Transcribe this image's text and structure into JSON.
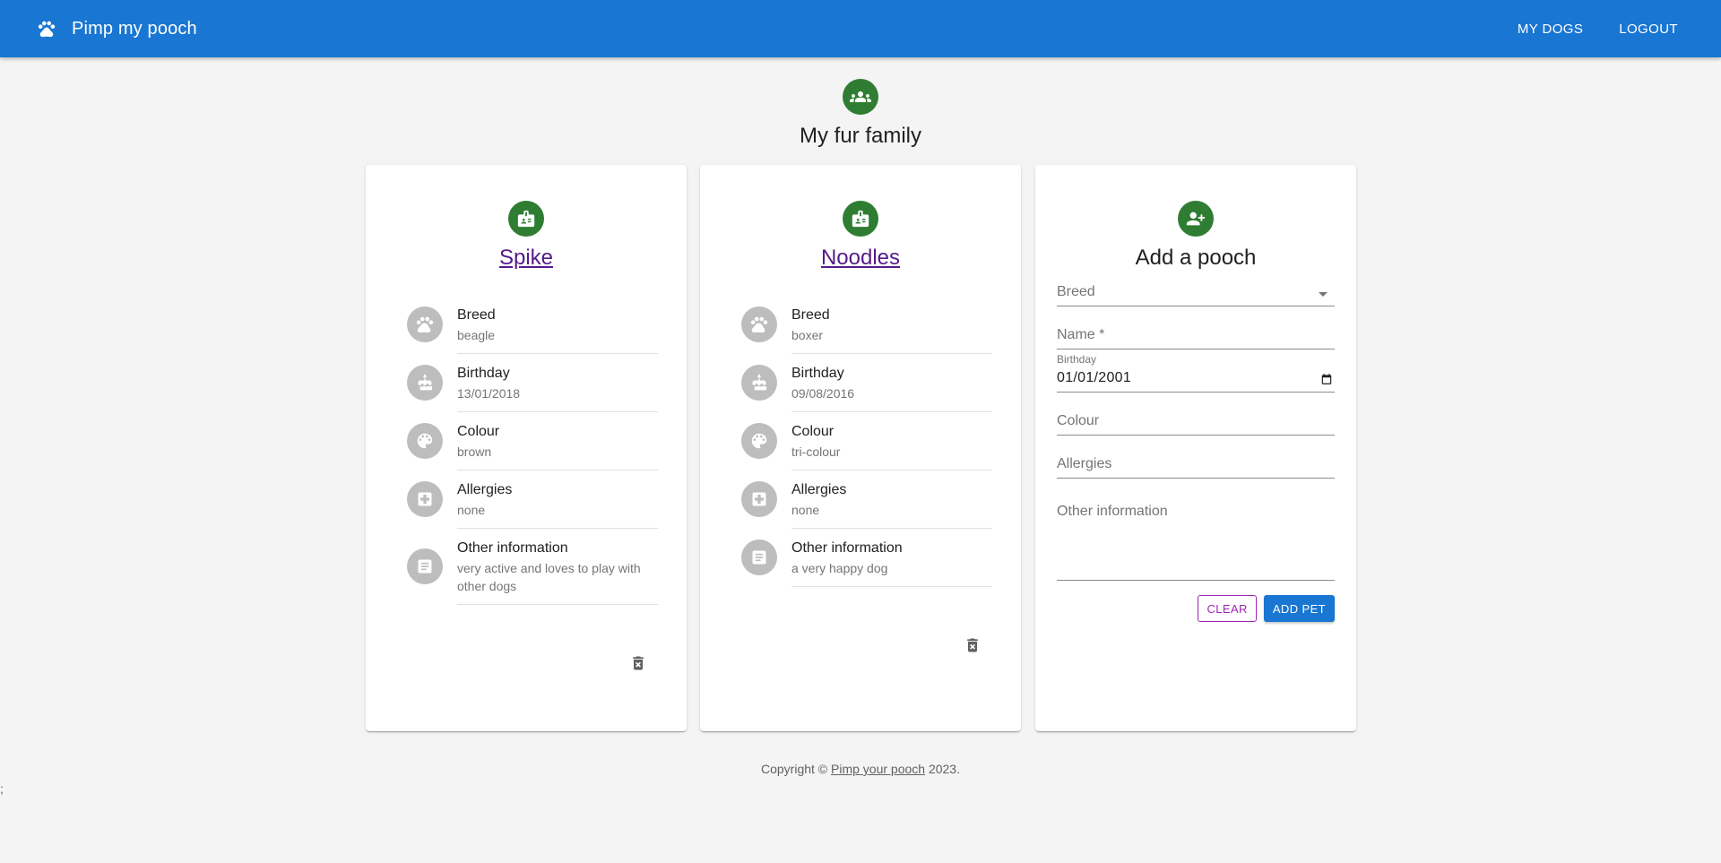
{
  "appbar": {
    "title": "Pimp my pooch",
    "nav": [
      "MY DOGS",
      "LOGOUT"
    ],
    "color": "#1976d2"
  },
  "page": {
    "title": "My fur family"
  },
  "dogs": [
    {
      "name": "Spike",
      "items": [
        {
          "label": "Breed",
          "value": "beagle",
          "icon": "paw-icon"
        },
        {
          "label": "Birthday",
          "value": "13/01/2018",
          "icon": "cake-icon"
        },
        {
          "label": "Colour",
          "value": "brown",
          "icon": "palette-icon"
        },
        {
          "label": "Allergies",
          "value": "none",
          "icon": "medical-icon"
        },
        {
          "label": "Other information",
          "value": "very active and loves to play with other dogs",
          "icon": "notes-icon"
        }
      ]
    },
    {
      "name": "Noodles",
      "items": [
        {
          "label": "Breed",
          "value": "boxer",
          "icon": "paw-icon"
        },
        {
          "label": "Birthday",
          "value": "09/08/2016",
          "icon": "cake-icon"
        },
        {
          "label": "Colour",
          "value": "tri-colour",
          "icon": "palette-icon"
        },
        {
          "label": "Allergies",
          "value": "none",
          "icon": "medical-icon"
        },
        {
          "label": "Other information",
          "value": "a very happy dog",
          "icon": "notes-icon"
        }
      ]
    }
  ],
  "form": {
    "title": "Add a pooch",
    "breed_placeholder": "Breed",
    "name_placeholder": "Name *",
    "birthday_label": "Birthday",
    "birthday_value": "01/01/2001",
    "colour_placeholder": "Colour",
    "allergies_placeholder": "Allergies",
    "other_placeholder": "Other information",
    "clear_label": "CLEAR",
    "add_label": "ADD PET"
  },
  "footer": {
    "prefix": "Copyright © ",
    "link": "Pimp your pooch",
    "suffix": " 2023."
  },
  "stray_text": ";"
}
